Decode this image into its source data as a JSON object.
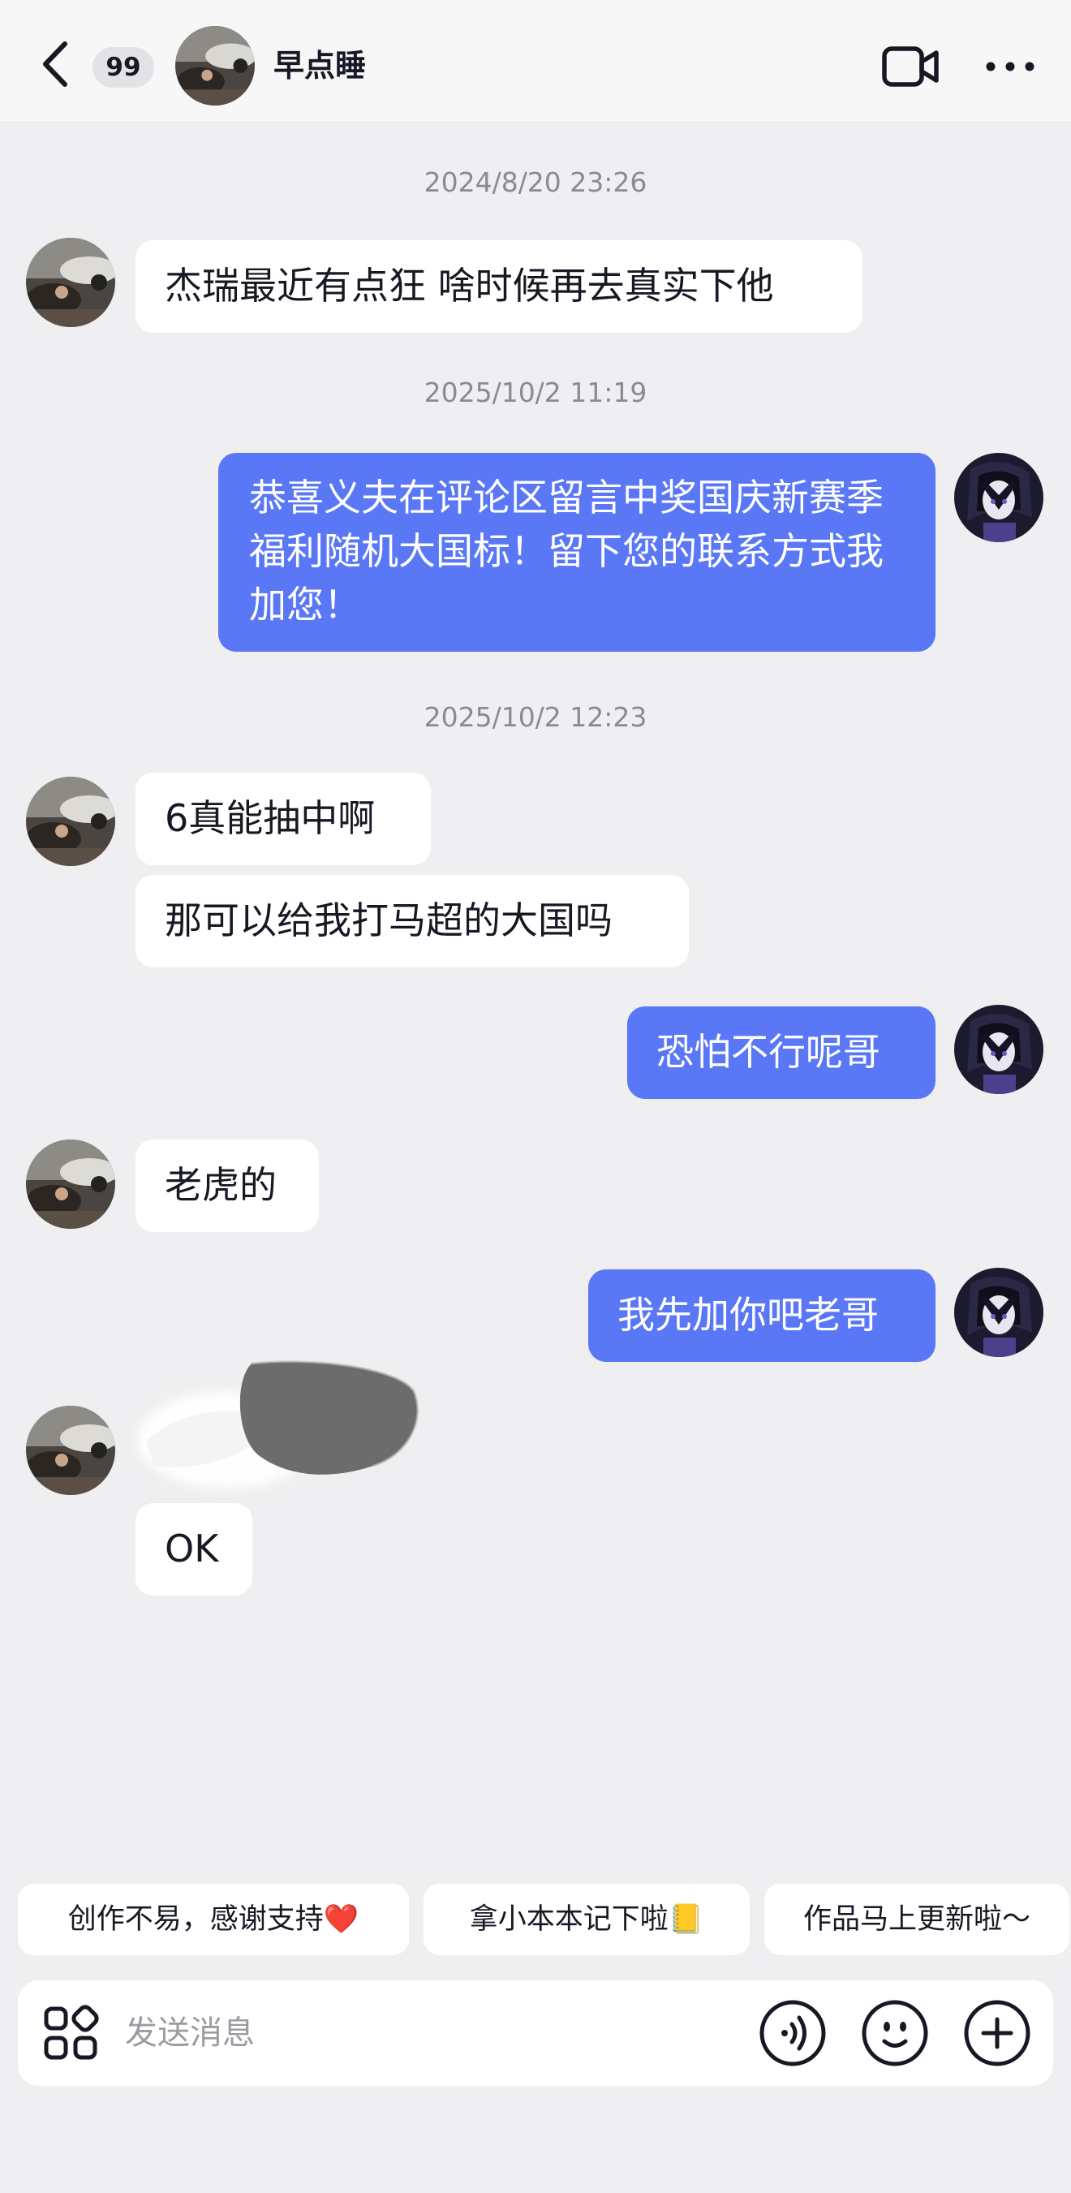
{
  "header": {
    "unread_count": "99",
    "contact_name": "早点睡"
  },
  "messages": {
    "ts_1": "2024/8/20 23:26",
    "m1": "杰瑞最近有点狂 啥时候再去真实下他",
    "ts_2": "2025/10/2 11:19",
    "m2": "恭喜义夫在评论区留言中奖国庆新赛季福利随机大国标！留下您的联系方式我加您！",
    "ts_3": "2025/10/2 12:23",
    "m3": "6真能抽中啊",
    "m4": "那可以给我打马超的大国吗",
    "m5": "恐怕不行呢哥",
    "m6": "老虎的",
    "m7": "我先加你吧老哥",
    "m8": "OK"
  },
  "quick_replies": [
    "创作不易，感谢支持❤️",
    "拿小本本记下啦📒",
    "作品马上更新啦～"
  ],
  "composer": {
    "placeholder": "发送消息"
  },
  "icons": {
    "back": "chevron-left-icon",
    "video": "video-call-icon",
    "more": "more-dots-icon",
    "apps": "apps-grid-icon",
    "voice": "voice-icon",
    "emoji": "emoji-icon",
    "plus": "plus-icon"
  },
  "colors": {
    "outgoing_bubble": "#5a78f6",
    "incoming_bubble": "#ffffff",
    "background": "#efeff1",
    "timestamp": "#8a8b91"
  }
}
